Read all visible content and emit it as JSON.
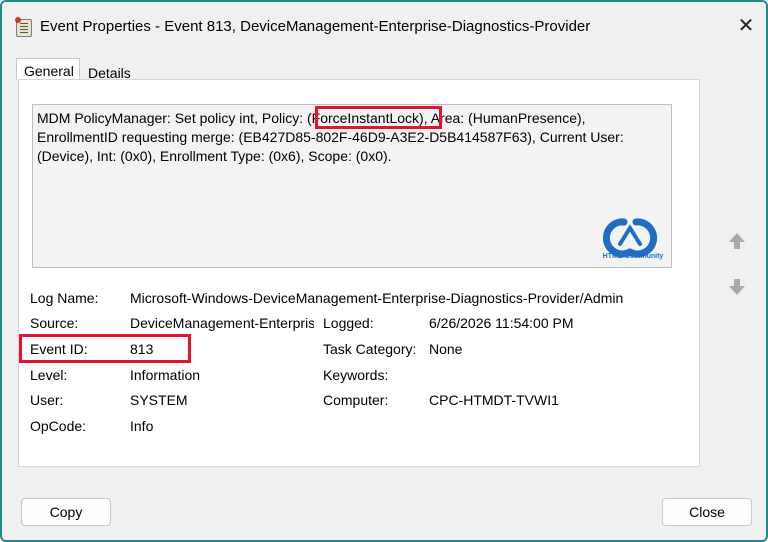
{
  "window": {
    "title": "Event Properties - Event 813, DeviceManagement-Enterprise-Diagnostics-Provider",
    "close_glyph": "✕"
  },
  "tabs": [
    {
      "label": "General",
      "active": true
    },
    {
      "label": "Details",
      "active": false
    }
  ],
  "description": {
    "lines": [
      "MDM PolicyManager: Set policy int, Policy: (ForceInstantLock), Area: (HumanPresence),",
      "EnrollmentID requesting merge: (EB427D85-802F-46D9-A3E2-D5B414587F63), Current User:",
      "(Device), Int: (0x0), Enrollment Type: (0x6), Scope: (0x0)."
    ],
    "highlight_color": "#e3142b"
  },
  "logo": {
    "name": "htmd-community-logo",
    "text": "HTMD Community",
    "color": "#1e6fc4"
  },
  "fields": {
    "log_name_label": "Log Name:",
    "log_name_value": "Microsoft-Windows-DeviceManagement-Enterprise-Diagnostics-Provider/Admin",
    "source_label": "Source:",
    "source_value": "DeviceManagement-Enterprise-Diagnostics-Provider",
    "logged_label": "Logged:",
    "logged_value": "6/26/2026 11:54:00 PM",
    "event_id_label": "Event ID:",
    "event_id_value": "813",
    "task_category_label": "Task Category:",
    "task_category_value": "None",
    "level_label": "Level:",
    "level_value": "Information",
    "keywords_label": "Keywords:",
    "keywords_value": "",
    "user_label": "User:",
    "user_value": "SYSTEM",
    "computer_label": "Computer:",
    "computer_value": "CPC-HTMDT-TVWI1",
    "opcode_label": "OpCode:",
    "opcode_value": "Info"
  },
  "buttons": {
    "copy_label": "Copy",
    "close_label": "Close"
  },
  "colors": {
    "accent_border": "#1e8a8a",
    "highlight": "#e3142b"
  }
}
